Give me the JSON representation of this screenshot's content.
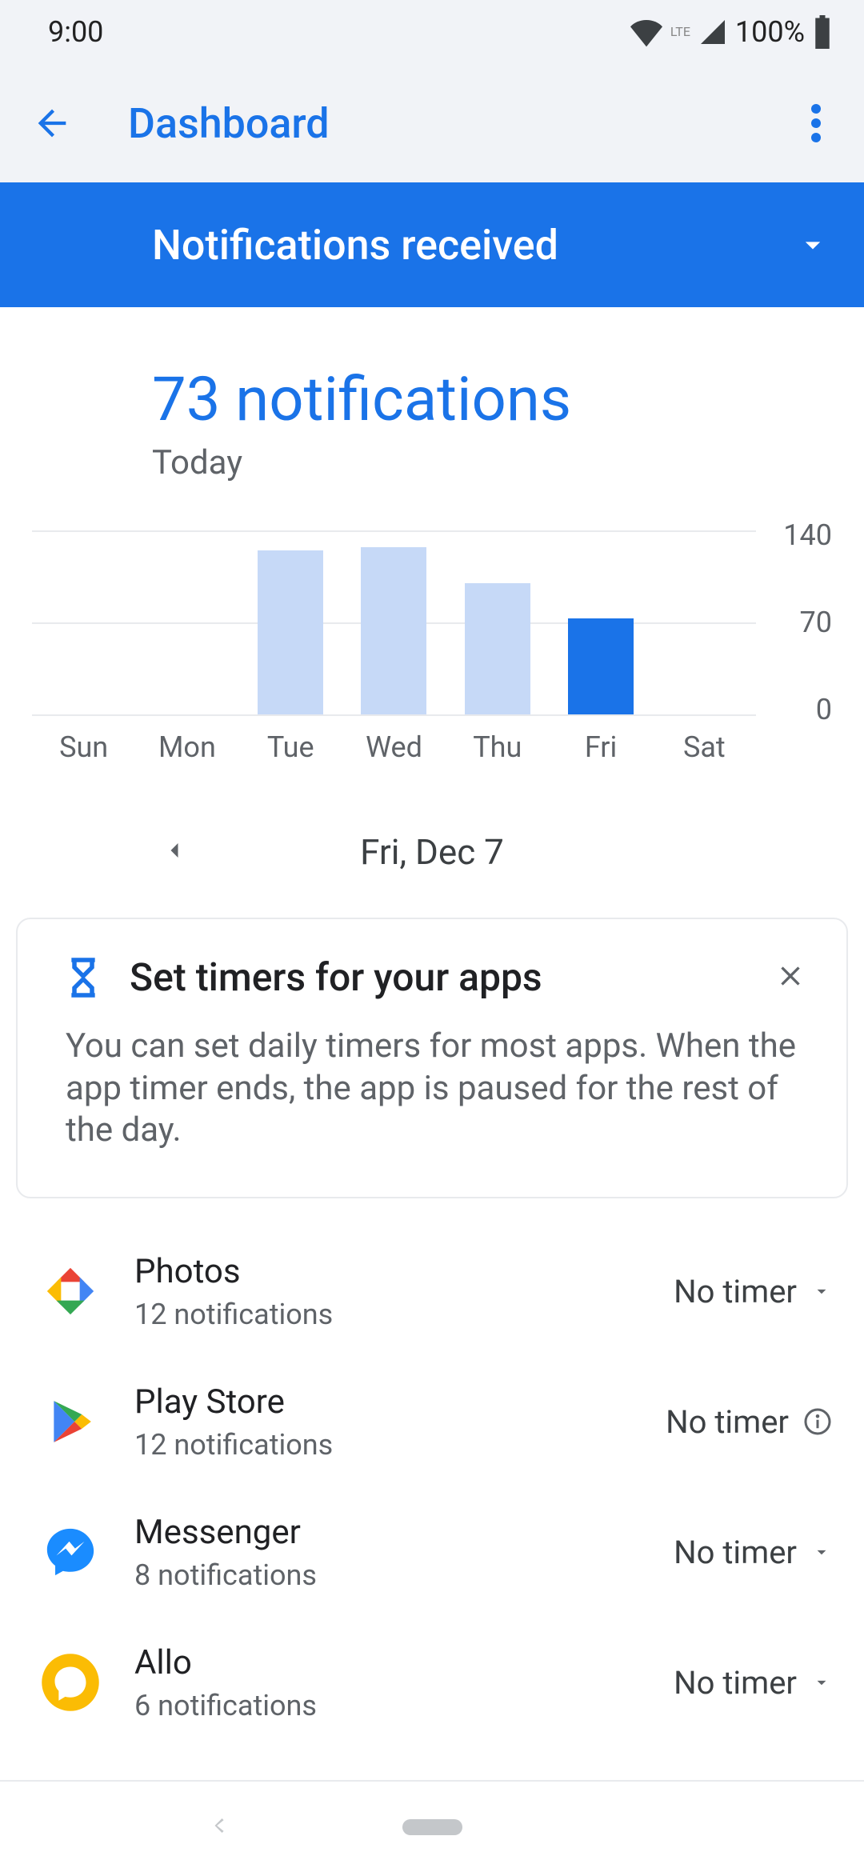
{
  "status": {
    "time": "9:00",
    "battery": "100%"
  },
  "header": {
    "title": "Dashboard"
  },
  "filter": {
    "label": "Notifications received"
  },
  "summary": {
    "count_text": "73 notifications",
    "sub": "Today"
  },
  "chart_data": {
    "type": "bar",
    "categories": [
      "Sun",
      "Mon",
      "Tue",
      "Wed",
      "Thu",
      "Fri",
      "Sat"
    ],
    "values": [
      0,
      0,
      125,
      127,
      100,
      73,
      0
    ],
    "highlight_index": 5,
    "ylabel": "",
    "xlabel": "",
    "ylim": [
      0,
      140
    ],
    "yticks": [
      0,
      70,
      140
    ],
    "colors": {
      "bar": "#c6d9f7",
      "highlight": "#1a73e8"
    }
  },
  "date_nav": {
    "date": "Fri, Dec 7"
  },
  "card": {
    "title": "Set timers for your apps",
    "body": "You can set daily timers for most apps. When the app timer ends, the app is paused for the rest of the day."
  },
  "timer_label": "No timer",
  "apps": [
    {
      "name": "Photos",
      "sub": "12 notifications",
      "timer": "No timer",
      "trailing": "dropdown"
    },
    {
      "name": "Play Store",
      "sub": "12 notifications",
      "timer": "No timer",
      "trailing": "info"
    },
    {
      "name": "Messenger",
      "sub": "8 notifications",
      "timer": "No timer",
      "trailing": "dropdown"
    },
    {
      "name": "Allo",
      "sub": "6 notifications",
      "timer": "No timer",
      "trailing": "dropdown"
    }
  ]
}
